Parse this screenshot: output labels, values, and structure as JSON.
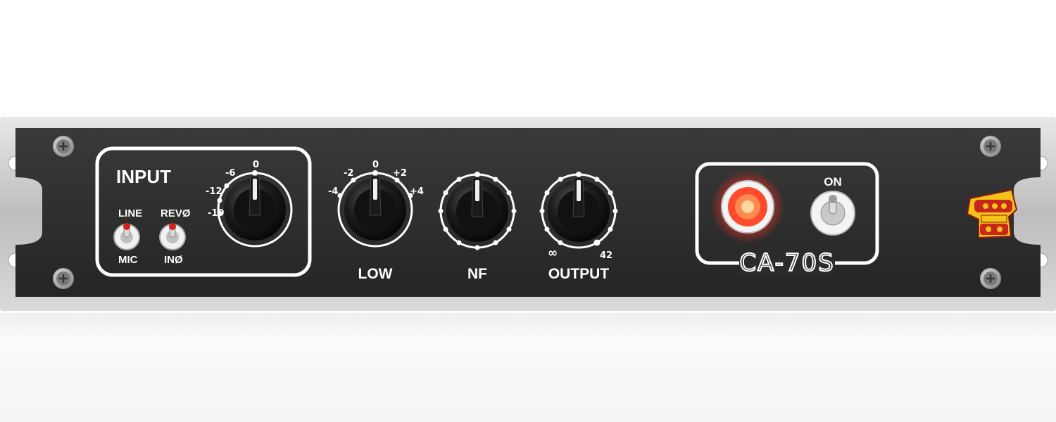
{
  "input": {
    "title": "INPUT",
    "line_label": "LINE",
    "mic_label": "MIC",
    "rev_label": "REVØ",
    "in_label": "INØ",
    "gain_scale": [
      "-19",
      "-12",
      "-6",
      "0"
    ]
  },
  "knobs": {
    "low": {
      "label": "LOW",
      "scale": [
        "-4",
        "-2",
        "0",
        "+2",
        "+4"
      ]
    },
    "nf": {
      "label": "NF"
    },
    "output": {
      "label": "OUTPUT",
      "scale_min": "∞",
      "scale_max": "42"
    }
  },
  "power": {
    "label": "ON",
    "model": "CA-70S",
    "lamp_state": "lit"
  },
  "logo": {
    "alt": "COIL AUDIO JOJ"
  },
  "colors": {
    "panel": "#2d2c2c",
    "rack": "#c8c8c8",
    "lamp": "#ff3b2a",
    "logo_red": "#c8271d",
    "logo_yellow": "#f3c21b"
  }
}
